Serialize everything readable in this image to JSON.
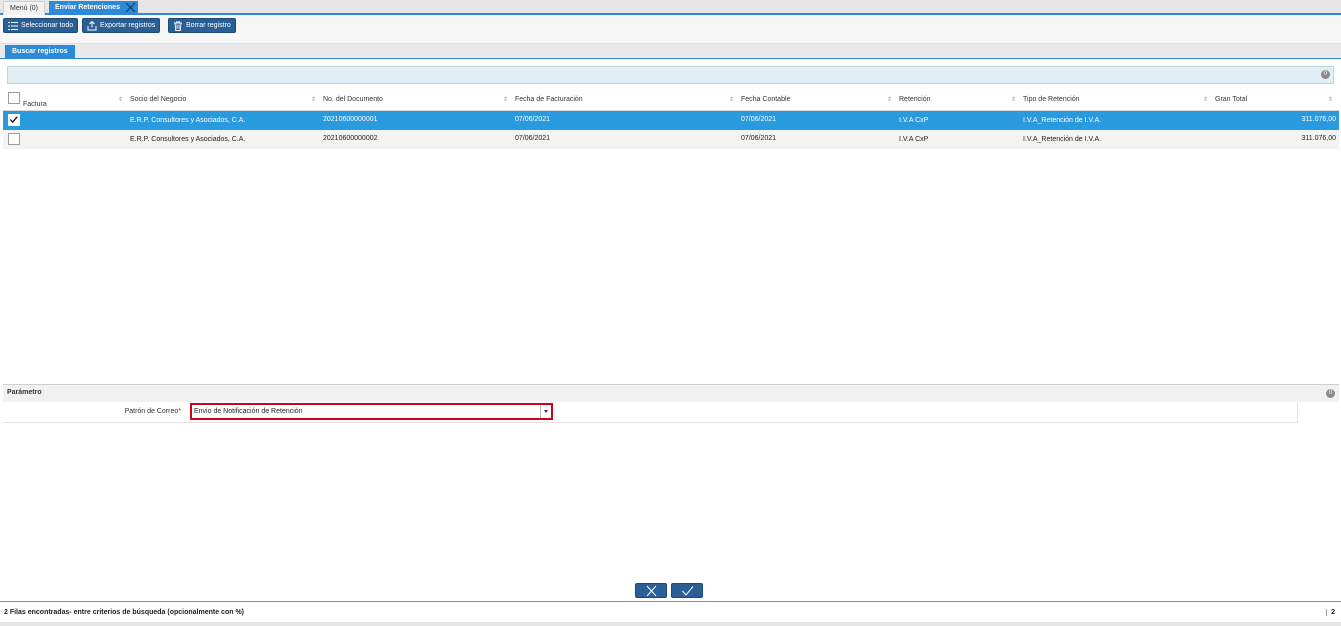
{
  "tabs": {
    "menu_label": "Menú (0)",
    "active_label": "Enviar Retenciones"
  },
  "toolbar": {
    "select_all_label": "Seleccionar todo",
    "export_label": "Exportar registros",
    "delete_label": "Borrar registro"
  },
  "search": {
    "tab_label": "Buscar registros",
    "collapse_glyph": "0"
  },
  "grid": {
    "columns": {
      "factura": "Factura",
      "socio": "Socio del Negocio",
      "documento": "No. del Documento",
      "fecha_facturacion": "Fecha de Facturación",
      "fecha_contable": "Fecha Contable",
      "retencion": "Retención",
      "tipo_retencion": "Tipo de Retención",
      "gran_total": "Gran Total"
    },
    "rows": [
      {
        "selected": true,
        "socio": "E.R.P. Consultores y Asociados, C.A.",
        "documento": "20210600000001",
        "fecha_facturacion": "07/06/2021",
        "fecha_contable": "07/06/2021",
        "retencion": "I.V.A CxP",
        "tipo_retencion": "I.V.A_Retención de I.V.A.",
        "gran_total": "311.076,00"
      },
      {
        "selected": false,
        "socio": "E.R.P. Consultores y Asociados, C.A.",
        "documento": "20210600000002",
        "fecha_facturacion": "07/06/2021",
        "fecha_contable": "07/06/2021",
        "retencion": "I.V.A CxP",
        "tipo_retencion": "I.V.A_Retención de I.V.A.",
        "gran_total": "311.076,00"
      }
    ]
  },
  "parameters": {
    "section_title": "Parámetro",
    "collapse_glyph": "0",
    "mail_template_label": "Patrón de Correo",
    "required_mark": "*",
    "mail_template_value": "Envio de Notificación de Retención"
  },
  "status": {
    "message": "2 Filas encontradas- entre criterios de búsqueda (opcionalmente con %)",
    "count": "2"
  },
  "colors": {
    "accent": "#2d8ad6",
    "button": "#2a5f96",
    "selected_row": "#2a9ade",
    "required_border": "#d0021b"
  }
}
